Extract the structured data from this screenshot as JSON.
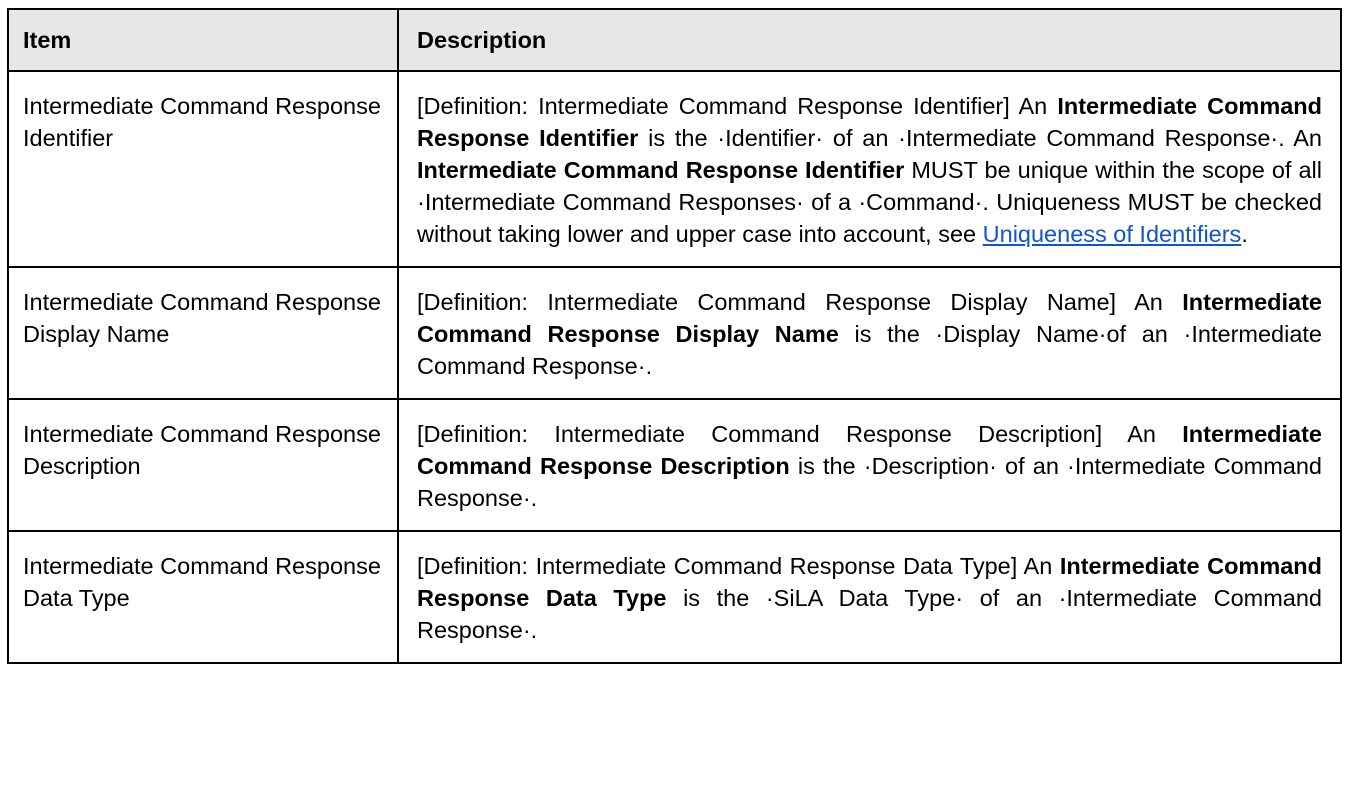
{
  "table": {
    "headers": [
      "Item",
      "Description"
    ],
    "rows": [
      {
        "item": "Intermediate Command Response Identifier",
        "desc": {
          "intro": "[Definition: Intermediate Command Response Identifier] An",
          "term1": "Intermediate Command Response Identifier",
          "mid1": "is the ·Identifier· of an ·Intermediate Command Response·. An",
          "term2": "Intermediate Command Response Identifier",
          "mid2": "MUST be unique within the scope of all ·Intermediate Command Responses· of a ·Command·. Uniqueness MUST be checked without taking lower and upper case into account, see",
          "link": "Uniqueness of Identifiers",
          "end": "."
        }
      },
      {
        "item": "Intermediate Command Response Display Name",
        "desc": {
          "intro": "[Definition: Intermediate Command Response Display Name] An",
          "term": "Intermediate Command Response Display Name",
          "rest": "is the ·Display Name·of an ·Intermediate Command Response·."
        }
      },
      {
        "item": "Intermediate Command Response Description",
        "desc": {
          "intro": "[Definition: Intermediate Command Response Description] An",
          "term": "Intermediate Command Response Description",
          "rest": "is the ·Description· of an ·Intermediate Command Response·."
        }
      },
      {
        "item": "Intermediate Command Response Data Type",
        "desc": {
          "intro": "[Definition: Intermediate Command Response Data Type] An",
          "term": "Intermediate Command Response Data Type",
          "rest": "is the ·SiLA Data Type· of an ·Intermediate Command Response·."
        }
      }
    ]
  }
}
